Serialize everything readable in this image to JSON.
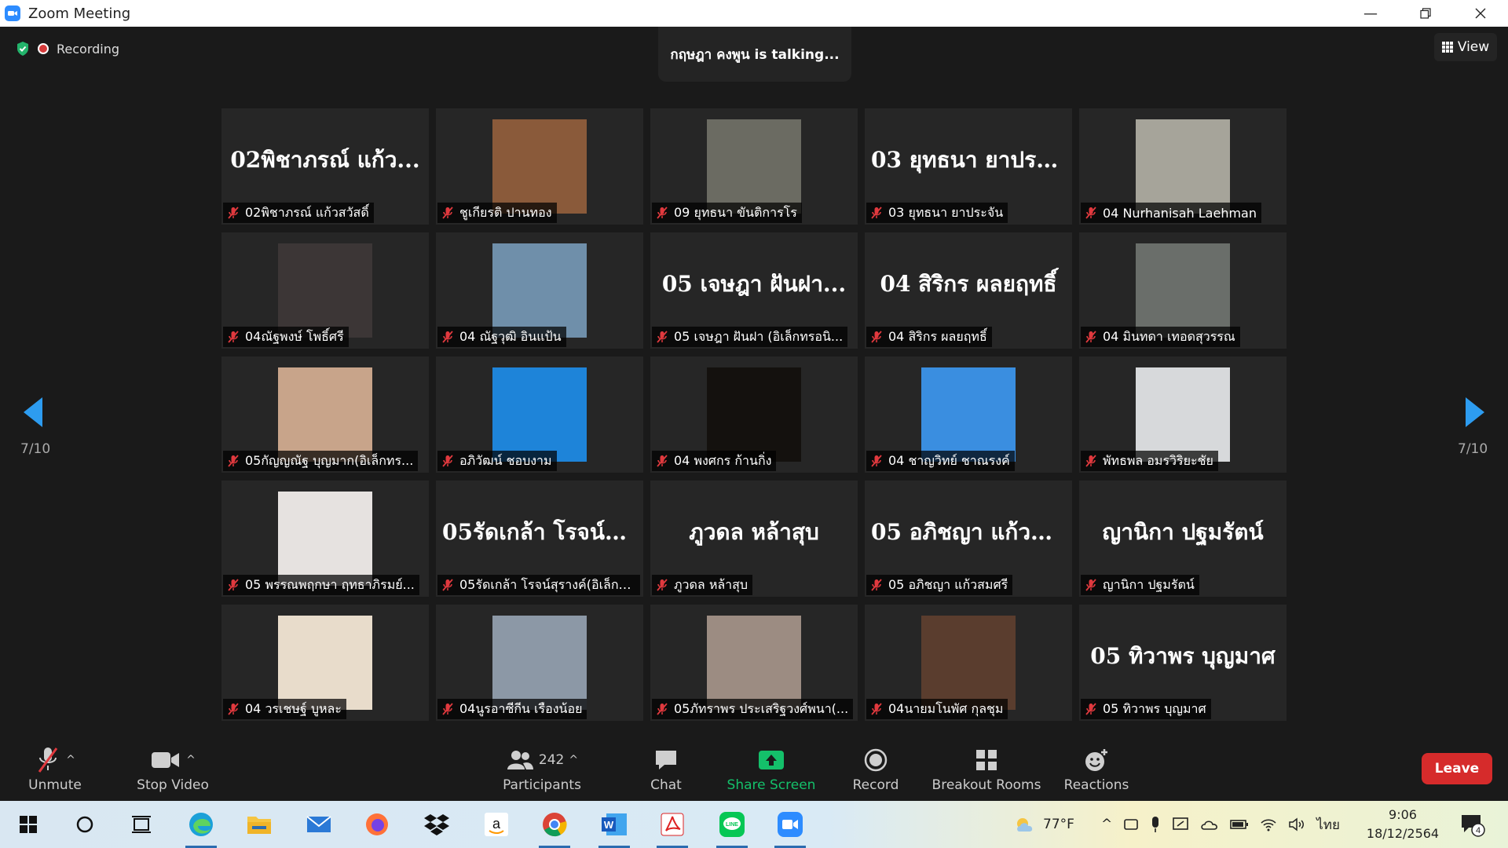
{
  "window": {
    "title": "Zoom Meeting"
  },
  "recording": {
    "label": "Recording"
  },
  "talking": {
    "text": "กฤษฎา คงพูน is talking..."
  },
  "view": {
    "label": "View"
  },
  "pagination": {
    "left": "7/10",
    "right": "7/10"
  },
  "tiles": [
    {
      "type": "name",
      "big": "02พิชาภรณ์ แก้ว...",
      "label": "02พิชาภรณ์ แก้วสวัสดิ์"
    },
    {
      "type": "photo",
      "label": "ชูเกียรติ ปานทอง",
      "color": "#8a5a3a"
    },
    {
      "type": "photo",
      "label": "09 ยุทธนา ขันติการโร",
      "color": "#6b6b62"
    },
    {
      "type": "name",
      "big": "03 ยุทธนา ยาประ...",
      "label": "03 ยุทธนา ยาประจัน"
    },
    {
      "type": "photo",
      "label": "04 Nurhanisah Laehman",
      "color": "#a6a49a"
    },
    {
      "type": "photo",
      "label": "04ณัฐพงษ์ โพธิ์ศรี",
      "color": "#3c3636"
    },
    {
      "type": "photo",
      "label": "04 ณัฐวุฒิ อินแป้น",
      "color": "#6f8faa"
    },
    {
      "type": "name",
      "big": "05 เจษฎา ฝันฝา...",
      "label": "05 เจษฎา ฝันฝา (อิเล็กทรอนิ..."
    },
    {
      "type": "name",
      "big": "04 สิริกร ผลยฤทธิ์",
      "label": "04 สิริกร ผลยฤทธิ์"
    },
    {
      "type": "photo",
      "label": "04 มินทดา เทอดสุวรรณ",
      "color": "#6a6e6a"
    },
    {
      "type": "photo",
      "label": "05กัญญณัฐ บุญมาก(อิเล็กทร...",
      "color": "#c8a48a"
    },
    {
      "type": "photo",
      "label": "อภิวัฒน์ ชอบงาม",
      "color": "#1e84d9"
    },
    {
      "type": "photo",
      "label": "04 พงศกร ก้านกิ่ง",
      "color": "#14110e"
    },
    {
      "type": "photo",
      "label": "04 ชาญวิทย์ ชาณรงค์",
      "color": "#3a8ee0"
    },
    {
      "type": "photo",
      "label": "พัทธพล อมรวิริยะชัย",
      "color": "#d7d9db"
    },
    {
      "type": "photo",
      "label": "05 พรรณพฤกษา ฤทธาภิรมย์...",
      "color": "#e6e2e0"
    },
    {
      "type": "name",
      "big": "05รัดเกล้า โรจน์สุ...",
      "label": "05รัดเกล้า โรจน์สุรางค์(อิเล็กท..."
    },
    {
      "type": "name",
      "big": "ภูวดล หล้าสุบ",
      "label": "ภูวดล หล้าสุบ"
    },
    {
      "type": "name",
      "big": "05 อภิชญา แก้วส...",
      "label": "05 อภิชญา แก้วสมศรี"
    },
    {
      "type": "name",
      "big": "ญานิกา ปฐมรัตน์",
      "label": "ญานิกา ปฐมรัตน์"
    },
    {
      "type": "photo",
      "label": "04 วรเชษฐ์ บูหละ",
      "color": "#e8dccb"
    },
    {
      "type": "photo",
      "label": "04นูรอาซีกีน เรืองน้อย",
      "color": "#8c98a6"
    },
    {
      "type": "photo",
      "label": "05ภัทราพร ประเสริฐวงศ์พนา(...",
      "color": "#9c8c82"
    },
    {
      "type": "photo",
      "label": "04นายมโนพัศ กุลชุม",
      "color": "#5a3d2e"
    },
    {
      "type": "name",
      "big": "05 ทิวาพร บุญมาศ",
      "label": "05 ทิวาพร บุญมาศ"
    }
  ],
  "toolbar": {
    "unmute": "Unmute",
    "stop_video": "Stop Video",
    "participants_count": "242",
    "participants": "Participants",
    "chat": "Chat",
    "share_screen": "Share Screen",
    "record": "Record",
    "breakout_rooms": "Breakout Rooms",
    "reactions": "Reactions",
    "leave": "Leave"
  },
  "taskbar": {
    "temperature": "77°F",
    "language": "ไทย",
    "time": "9:06",
    "date": "18/12/2564",
    "notification_count": "4"
  }
}
